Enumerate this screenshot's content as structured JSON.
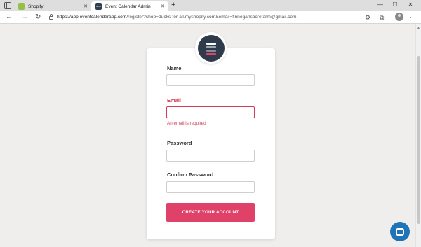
{
  "browser": {
    "tabs": [
      {
        "label": "Shopify",
        "favicon": "shopify-icon",
        "active": false
      },
      {
        "label": "Event Calendar Admin",
        "favicon": "event-calendar-icon",
        "favicon_text": "ECA",
        "active": true
      }
    ],
    "new_tab": "+",
    "url_host": "https://app.eventcalendarapp.com",
    "url_rest": "/register?shop=ducks-for-all.myshopify.com&email=finnegansacrefarm@gmail.com",
    "window_controls": {
      "minimize": "—",
      "maximize": "☐",
      "close": "✕"
    }
  },
  "form": {
    "name_label": "Name",
    "name_value": "",
    "email_label": "Email",
    "email_value": "",
    "email_error": "An email is required",
    "password_label": "Password",
    "password_value": "",
    "confirm_label": "Confirm Password",
    "confirm_value": "",
    "submit_label": "CREATE YOUR ACCOUNT"
  },
  "colors": {
    "accent": "#df4168",
    "error": "#d23c56",
    "logo_bg": "#2f3b4a",
    "chat": "#1f73b7"
  },
  "icons": {
    "chat": "chat-bubble-icon",
    "logo": "event-calendar-logo"
  }
}
